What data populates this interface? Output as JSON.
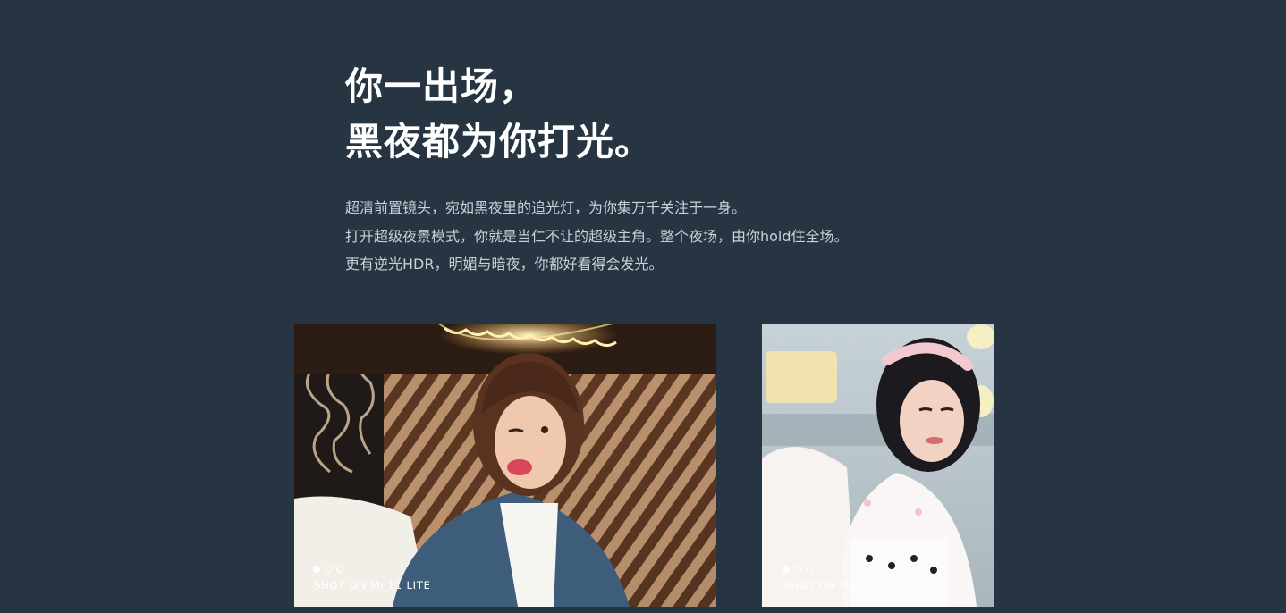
{
  "headline": {
    "line1": "你一出场，",
    "line2": "黑夜都为你打光。"
  },
  "description": {
    "line1": "超清前置镜头，宛如黑夜里的追光灯，为你集万千关注于一身。",
    "line2": "打开超级夜景模式，你就是当仁不让的超级主角。整个夜场，由你hold住全场。",
    "line3": "更有逆光HDR，明媚与暗夜，你都好看得会发光。"
  },
  "gallery": [
    {
      "caption": "SHOT ON MI 11 LITE",
      "dots": [
        true,
        false,
        false
      ]
    },
    {
      "caption": "SHOT ON MI 11 LITE",
      "dots": [
        true,
        false,
        false
      ]
    }
  ],
  "colors": {
    "background": "#263541",
    "headline": "#ffffff",
    "body_text": "#c9d0d6"
  }
}
